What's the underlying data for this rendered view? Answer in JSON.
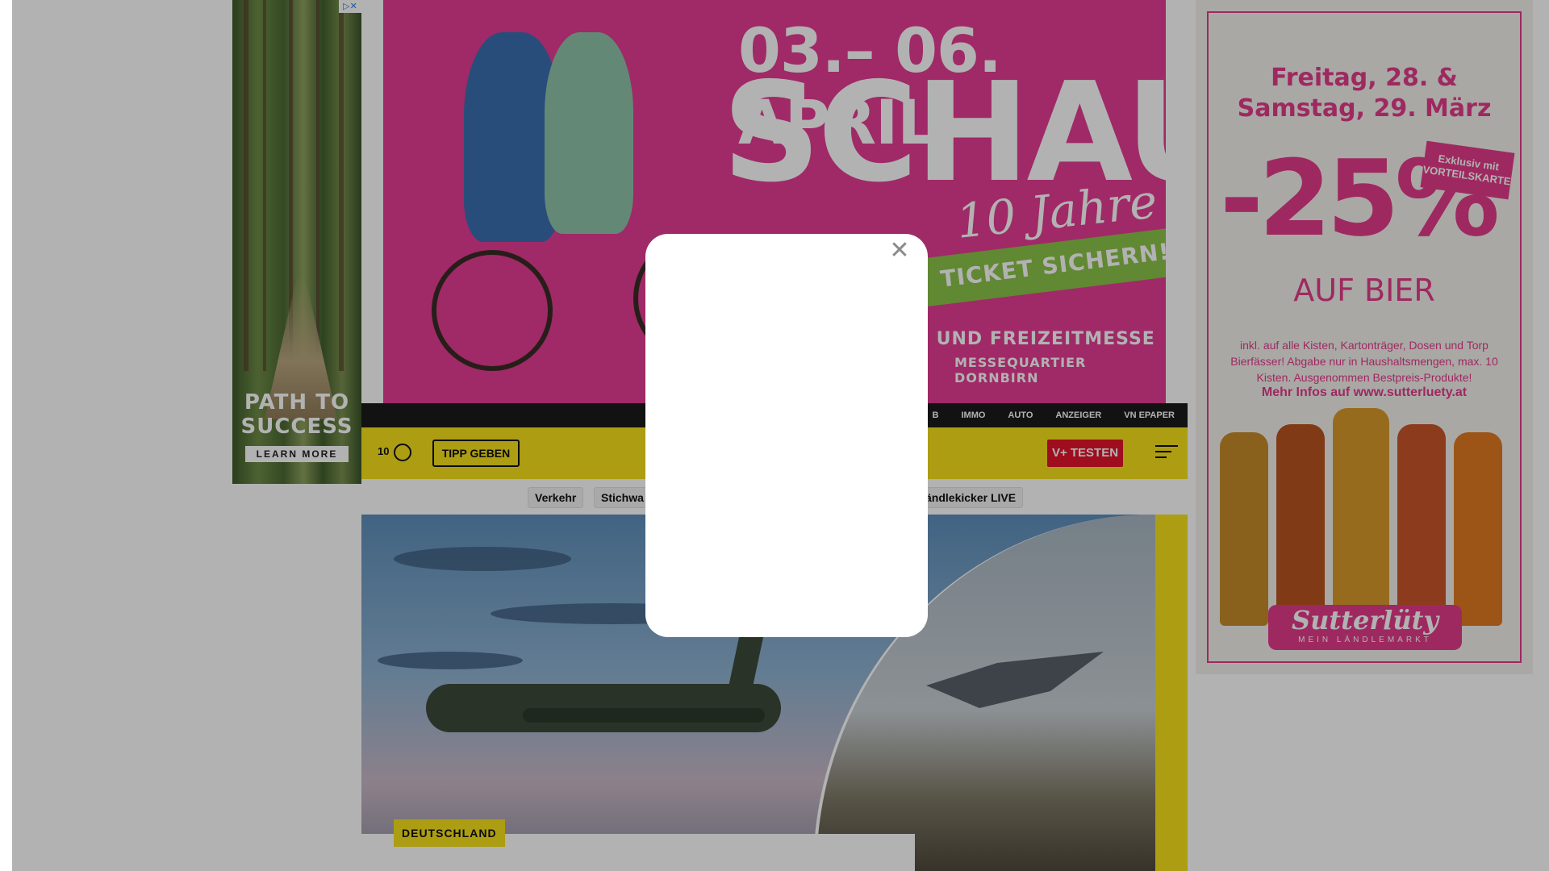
{
  "ads": {
    "left": {
      "title_line1": "PATH TO",
      "title_line2": "SUCCESS",
      "cta": "LEARN MORE",
      "ad_choices": "▷✕"
    },
    "top": {
      "date": "03.– 06. APRIL",
      "headline": "SCHAU!",
      "script": "10 Jahre",
      "ribbon": "TICKET SICHERN!",
      "sub1": "S- UND FREIZEITMESSE",
      "sub2": "MESSEQUARTIER DORNBIRN",
      "bg_color": "#e43d94"
    },
    "right": {
      "line1": "Freitag, 28. &",
      "line2": "Samstag, 29. März",
      "percent": "-25%",
      "badge_line1": "Exklusiv mit",
      "badge_line2": "VORTEILSKARTE",
      "product": "AUF BIER",
      "fine_print": "inkl. auf alle Kisten, Kartonträger, Dosen und Torp Bierfässer! Abgabe nur in Haushaltsmengen, max. 10 Kisten. Ausgenommen Bestpreis-Produkte!",
      "link": "Mehr Infos auf www.sutterluety.at",
      "logo": "Sutterlüty",
      "logo_sub": "MEIN LÄNDLEMARKT",
      "accent": "#e23c8a"
    }
  },
  "topbar": {
    "links": [
      "B",
      "IMMO",
      "AUTO",
      "ANZEIGER",
      "VN EPAPER"
    ]
  },
  "header": {
    "temp": "10",
    "weather_icon": "weather-icon",
    "tipp_label": "TIPP GEBEN",
    "vplus_label": "V+ TESTEN",
    "menu_icon": "menu-search-icon",
    "brand_yellow": "#f7e11c",
    "vplus_red": "#e2152b"
  },
  "tags": [
    "Verkehr",
    "Stichwa",
    "ändlekicker LIVE"
  ],
  "hero": {
    "kicker": "DEUTSCHLAND"
  },
  "modal": {
    "close_symbol": "✕"
  }
}
